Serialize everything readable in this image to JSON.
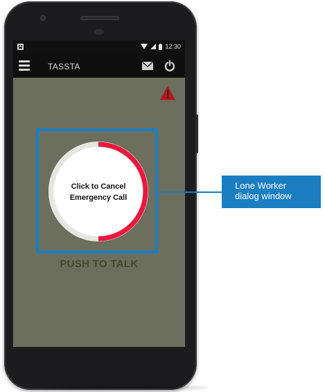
{
  "status_bar": {
    "time": "12:30"
  },
  "app_bar": {
    "title": "TASSTA",
    "menu_icon": "hamburger-menu-icon",
    "mail_icon": "envelope-icon",
    "power_icon": "power-icon"
  },
  "alert": {
    "icon": "warning-triangle-icon",
    "color": "#b0191e"
  },
  "emergency_dial": {
    "line1": "Click to Cancel",
    "line2": "Emergency Call",
    "progress": 0.5,
    "active_color": "#e8193c",
    "track_color": "#e6e6e0"
  },
  "ptt": {
    "label": "PUSH TO TALK"
  },
  "callout": {
    "line1": "Lone Worker",
    "line2": "dialog window",
    "color": "#1a7ec1"
  }
}
